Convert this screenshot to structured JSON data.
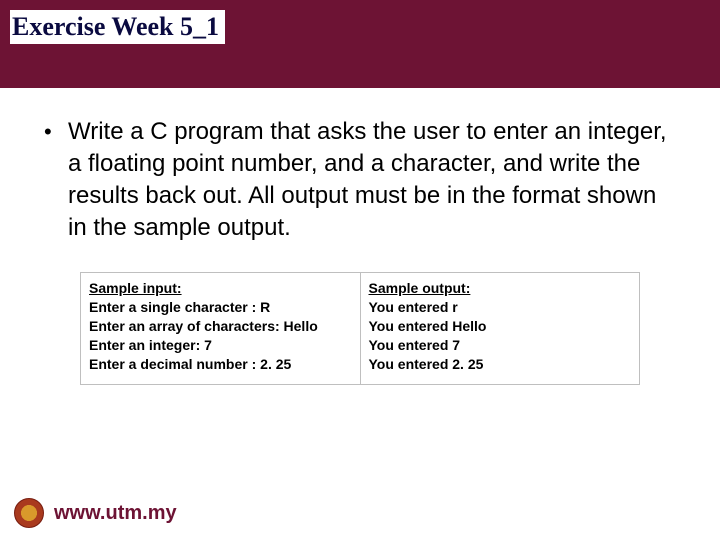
{
  "title": "Exercise Week 5_1",
  "bullet": "•",
  "body_text": "Write a C program that asks the user to enter an integer, a floating point number, and a character, and write the results back out. All output must be in the format shown in the sample output.",
  "sample": {
    "input": {
      "header": "Sample input:",
      "lines": [
        "Enter a single character : R",
        "Enter an array of characters: Hello",
        "Enter an integer: 7",
        "Enter a decimal number : 2. 25"
      ]
    },
    "output": {
      "header": "Sample output:",
      "lines": [
        "You entered r",
        "You entered Hello",
        "You entered 7",
        "You entered 2. 25"
      ]
    }
  },
  "footer": {
    "url": "www.utm.my"
  }
}
